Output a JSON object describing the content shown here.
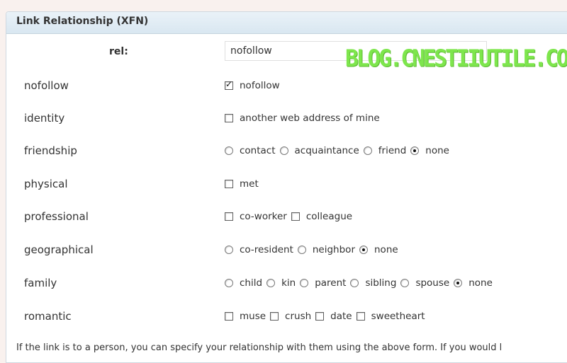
{
  "title": "Link Relationship (XFN)",
  "rel": {
    "label": "rel:",
    "value": "nofollow"
  },
  "watermark": "BLOG.CNESTIIUTILE.COM",
  "rows": [
    {
      "label": "nofollow",
      "options": [
        {
          "kind": "checkbox",
          "label": "nofollow",
          "checked": true
        }
      ]
    },
    {
      "label": "identity",
      "options": [
        {
          "kind": "checkbox",
          "label": "another web address of mine",
          "checked": false
        }
      ]
    },
    {
      "label": "friendship",
      "options": [
        {
          "kind": "radio",
          "label": "contact",
          "checked": false
        },
        {
          "kind": "radio",
          "label": "acquaintance",
          "checked": false
        },
        {
          "kind": "radio",
          "label": "friend",
          "checked": false
        },
        {
          "kind": "radio",
          "label": "none",
          "checked": true
        }
      ]
    },
    {
      "label": "physical",
      "options": [
        {
          "kind": "checkbox",
          "label": "met",
          "checked": false
        }
      ]
    },
    {
      "label": "professional",
      "options": [
        {
          "kind": "checkbox",
          "label": "co-worker",
          "checked": false
        },
        {
          "kind": "checkbox",
          "label": "colleague",
          "checked": false
        }
      ]
    },
    {
      "label": "geographical",
      "options": [
        {
          "kind": "radio",
          "label": "co-resident",
          "checked": false
        },
        {
          "kind": "radio",
          "label": "neighbor",
          "checked": false
        },
        {
          "kind": "radio",
          "label": "none",
          "checked": true
        }
      ]
    },
    {
      "label": "family",
      "options": [
        {
          "kind": "radio",
          "label": "child",
          "checked": false
        },
        {
          "kind": "radio",
          "label": "kin",
          "checked": false
        },
        {
          "kind": "radio",
          "label": "parent",
          "checked": false
        },
        {
          "kind": "radio",
          "label": "sibling",
          "checked": false
        },
        {
          "kind": "radio",
          "label": "spouse",
          "checked": false
        },
        {
          "kind": "radio",
          "label": "none",
          "checked": true
        }
      ]
    },
    {
      "label": "romantic",
      "options": [
        {
          "kind": "checkbox",
          "label": "muse",
          "checked": false
        },
        {
          "kind": "checkbox",
          "label": "crush",
          "checked": false
        },
        {
          "kind": "checkbox",
          "label": "date",
          "checked": false
        },
        {
          "kind": "checkbox",
          "label": "sweetheart",
          "checked": false
        }
      ]
    }
  ],
  "footer": "If the link is to a person, you can specify your relationship with them using the above form. If you would l"
}
